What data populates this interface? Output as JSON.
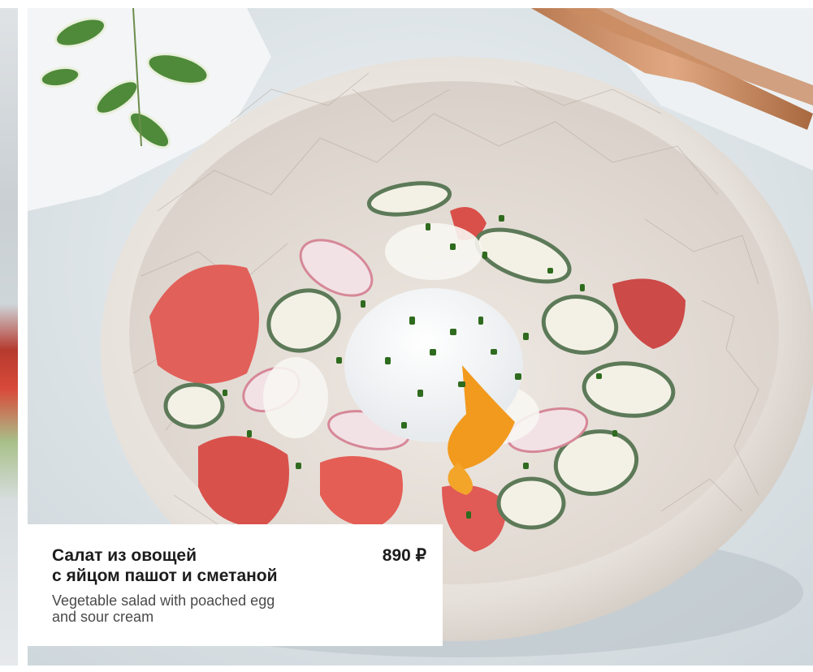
{
  "dish": {
    "title_ru_line1": "Салат из овощей",
    "title_ru_line2": "с яйцом пашот и сметаной",
    "price": "890 ₽",
    "title_en_line1": "Vegetable salad with poached egg",
    "title_en_line2": "and sour cream"
  },
  "colors": {
    "caption_background": "#ffffff",
    "title_text": "#1c1c1c",
    "subtitle_text": "#4a4a4a"
  }
}
